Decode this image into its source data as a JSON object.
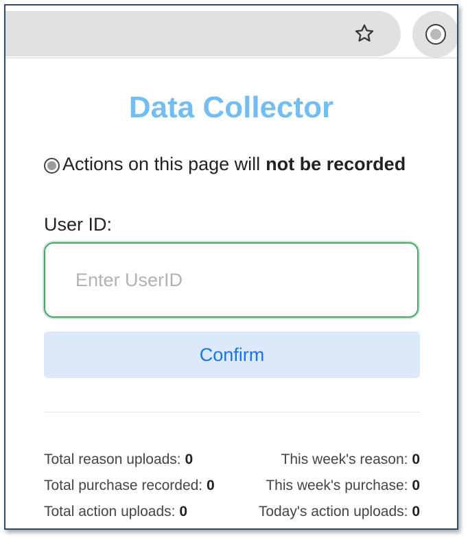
{
  "browser": {
    "bookmark_icon": "star-icon",
    "extension_icon": "record-icon"
  },
  "popup": {
    "title": "Data Collector",
    "status": {
      "icon": "radio-record-icon",
      "text_prefix": "Actions on this page will",
      "text_emphasis": "not be recorded"
    },
    "userid": {
      "label": "User ID:",
      "value": "",
      "placeholder": "Enter UserID"
    },
    "confirm_label": "Confirm",
    "stats": [
      {
        "left_label": "Total reason uploads:",
        "left_value": "0",
        "right_label": "This week's reason:",
        "right_value": "0"
      },
      {
        "left_label": "Total purchase recorded:",
        "left_value": "0",
        "right_label": "This week's purchase:",
        "right_value": "0"
      },
      {
        "left_label": "Total action uploads:",
        "left_value": "0",
        "right_label": "Today's action uploads:",
        "right_value": "0"
      }
    ]
  },
  "colors": {
    "title": "#72bdf2",
    "confirm_bg": "#dce9fa",
    "confirm_text": "#1a73e8",
    "input_border": "#4aa66a"
  }
}
